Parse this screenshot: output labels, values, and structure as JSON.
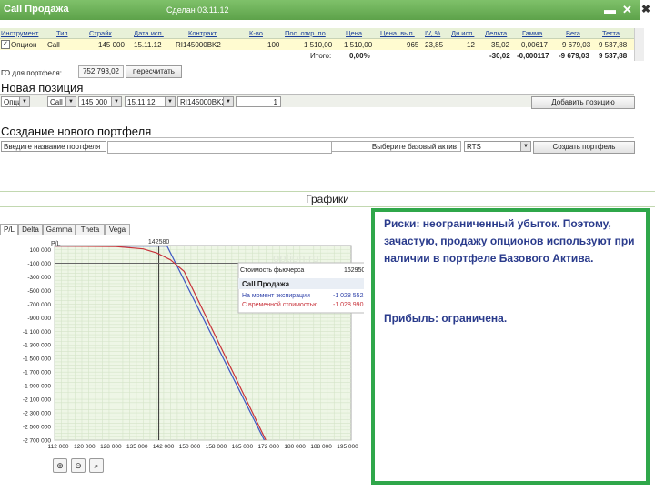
{
  "window": {
    "title": "Call Продажа",
    "subtitle": "Сделан 03.11.12",
    "controls": [
      "▬",
      "✕",
      "✖"
    ]
  },
  "positions_table": {
    "headers": [
      "Инструмент",
      "Тип",
      "Страйк",
      "Дата исп.",
      "Контракт",
      "К-во",
      "Пос. откр. по",
      "Цена",
      "Цена. вып.",
      "IV, %",
      "Дн исп.",
      "Дельта",
      "Гамма",
      "Вега",
      "Тетта"
    ],
    "row": [
      "Опцион",
      "Call",
      "145 000",
      "15.11.12",
      "RI145000BK2",
      "100",
      "1 510,00",
      "1 510,00",
      "965",
      "23,85",
      "12",
      "35,02",
      "0,00617",
      "9 679,03",
      "9 537,88"
    ],
    "totals": {
      "label": "Итого:",
      "values": [
        "0,00%",
        "-30,02",
        "-0,000117",
        "-9 679,03",
        "9 537,88"
      ]
    }
  },
  "go": {
    "label": "ГО для портфеля:",
    "value": "752 793,02",
    "button": "пересчитать"
  },
  "new_position": {
    "heading": "Новая позиция",
    "instrument": "Опцион",
    "type": "Call",
    "strike": "145 000",
    "date": "15.11.12",
    "contract": "RI145000BK2",
    "quantity": "1",
    "add_button": "Добавить позицию"
  },
  "new_portfolio": {
    "heading": "Создание нового портфеля",
    "name_placeholder": "Введите название портфеля",
    "base_label": "Выберите базовый актив",
    "base_value": "RTS",
    "create_button": "Создать портфель"
  },
  "charts_section": {
    "title": "Графики"
  },
  "tabs": [
    "P/L",
    "Delta",
    "Gamma",
    "Theta",
    "Vega"
  ],
  "chart_data": {
    "type": "line",
    "ylabel": "P/L",
    "marker_label": "142580",
    "marker_x": 142580,
    "x_ticks": [
      "112 000",
      "120 000",
      "128 000",
      "135 000",
      "142 000",
      "150 000",
      "158 000",
      "165 000",
      "172 000",
      "180 000",
      "188 000",
      "195 000"
    ],
    "y_ticks": [
      "100 000",
      "-100 000",
      "-300 000",
      "-500 000",
      "-700 000",
      "-900 000",
      "-1 100 000",
      "-1 300 000",
      "-1 500 000",
      "-1 700 000",
      "-1 900 000",
      "-2 100 000",
      "-2 300 000",
      "-2 500 000",
      "-2 700 000"
    ],
    "xlim": [
      112000,
      199000
    ],
    "ylim": [
      -2700000,
      160000
    ],
    "series": [
      {
        "name": "На момент экспирации",
        "color": "#3e57c4",
        "x": [
          112000,
          145000,
          190000
        ],
        "y": [
          151000,
          151000,
          -4349000
        ]
      },
      {
        "name": "С временной стоимостью",
        "color": "#c8323a",
        "x": [
          112000,
          130000,
          138000,
          142000,
          146000,
          150000,
          190000
        ],
        "y": [
          150000,
          145000,
          110000,
          50000,
          -50000,
          -220000,
          -4360000
        ]
      }
    ],
    "watermark": "option.ru",
    "tooltip": {
      "price_label": "Стоимость фьючерса",
      "price_value": "162950",
      "title": "Call Продажа",
      "exp_label": "На момент экспирации",
      "exp_value": "-1 028 552",
      "tv_label": "С временной стоимостью",
      "tv_value": "-1 028 990"
    }
  },
  "note": {
    "risk": "Риски: неограниченный убыток. Поэтому, зачастую, продажу опционов используют при наличии в портфеле Базового Актива.",
    "profit": "Прибыль: ограничена."
  },
  "colors": {
    "accent": "#5da24a",
    "frame": "#2fa74a",
    "text_blue": "#2a3b8c"
  }
}
